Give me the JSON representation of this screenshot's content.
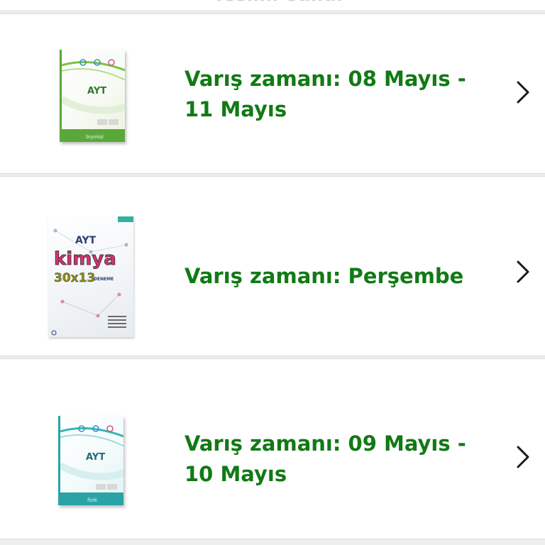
{
  "header": {
    "cut_text": "Teslim edildi"
  },
  "orders": [
    {
      "delivery_text": "Varış zamanı: 08 Mayıs - 11 Mayıs",
      "thumbnail": {
        "title": "AYT",
        "subtitle": "biyoloji"
      }
    },
    {
      "delivery_text": "Varış zamanı: Perşembe",
      "thumbnail": {
        "title": "AYT",
        "word": "kimya",
        "count": "30x13",
        "caption": "DENEME"
      }
    },
    {
      "delivery_text": "Varış zamanı: 09 Mayıs - 10 Mayıs",
      "thumbnail": {
        "title": "AYT",
        "subtitle": "fizik"
      }
    }
  ],
  "icons": {
    "chevron": "chevron-right-icon"
  },
  "colors": {
    "delivery_text": "#117a15",
    "chevron": "#1a1a1a",
    "background": "#eceeee",
    "card": "#ffffff"
  }
}
